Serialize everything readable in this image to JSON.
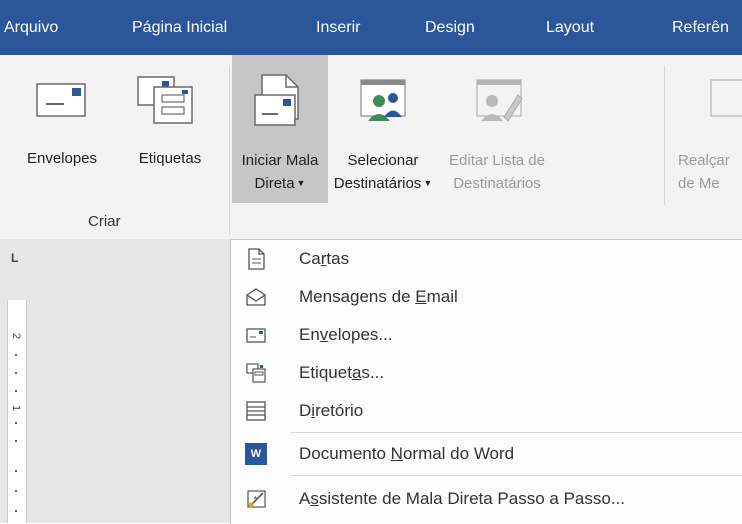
{
  "tabs": [
    "Arquivo",
    "Página Inicial",
    "Inserir",
    "Design",
    "Layout",
    "Referên"
  ],
  "ribbon": {
    "envelopes": "Envelopes",
    "etiquetas": "Etiquetas",
    "criar_group": "Criar",
    "iniciar_line1": "Iniciar Mala",
    "iniciar_line2": "Direta",
    "selecionar_line1": "Selecionar",
    "selecionar_line2": "Destinatários",
    "editar_line1": "Editar Lista de",
    "editar_line2": "Destinatários",
    "realcar_line1": "Realçar",
    "realcar_line2": "de Me"
  },
  "ruler": {
    "corner": "L",
    "num2": "2",
    "num1": "1"
  },
  "menu": {
    "items": [
      {
        "pre": "Ca",
        "key": "r",
        "post": "tas"
      },
      {
        "pre": "Mensagens de ",
        "key": "E",
        "post": "mail"
      },
      {
        "pre": "En",
        "key": "v",
        "post": "elopes..."
      },
      {
        "pre": "Etiquet",
        "key": "a",
        "post": "s..."
      },
      {
        "pre": "D",
        "key": "i",
        "post": "retório"
      },
      {
        "pre": "Documento ",
        "key": "N",
        "post": "ormal do Word"
      },
      {
        "pre": "A",
        "key": "s",
        "post": "sistente de Mala Direta Passo a Passo..."
      }
    ],
    "word_icon_text": "W"
  }
}
